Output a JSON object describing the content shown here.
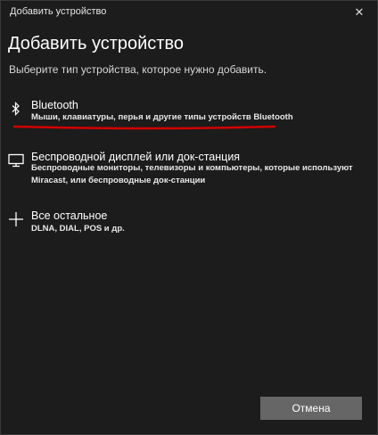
{
  "window": {
    "title": "Добавить устройство",
    "close_glyph": "✕"
  },
  "main": {
    "heading": "Добавить устройство",
    "subheading": "Выберите тип устройства, которое нужно добавить."
  },
  "options": [
    {
      "icon": "bluetooth-icon",
      "title": "Bluetooth",
      "description": "Мыши, клавиатуры, перья и другие типы устройств Bluetooth"
    },
    {
      "icon": "monitor-icon",
      "title": "Беспроводной дисплей или док-станция",
      "description": "Беспроводные мониторы, телевизоры и компьютеры, которые используют Miracast, или беспроводные док-станции"
    },
    {
      "icon": "plus-icon",
      "title": "Все остальное",
      "description": "DLNA, DIAL, POS и др."
    }
  ],
  "footer": {
    "cancel_label": "Отмена"
  },
  "colors": {
    "background": "#1c1c1c",
    "button": "#666666",
    "annotation": "#d40000"
  }
}
